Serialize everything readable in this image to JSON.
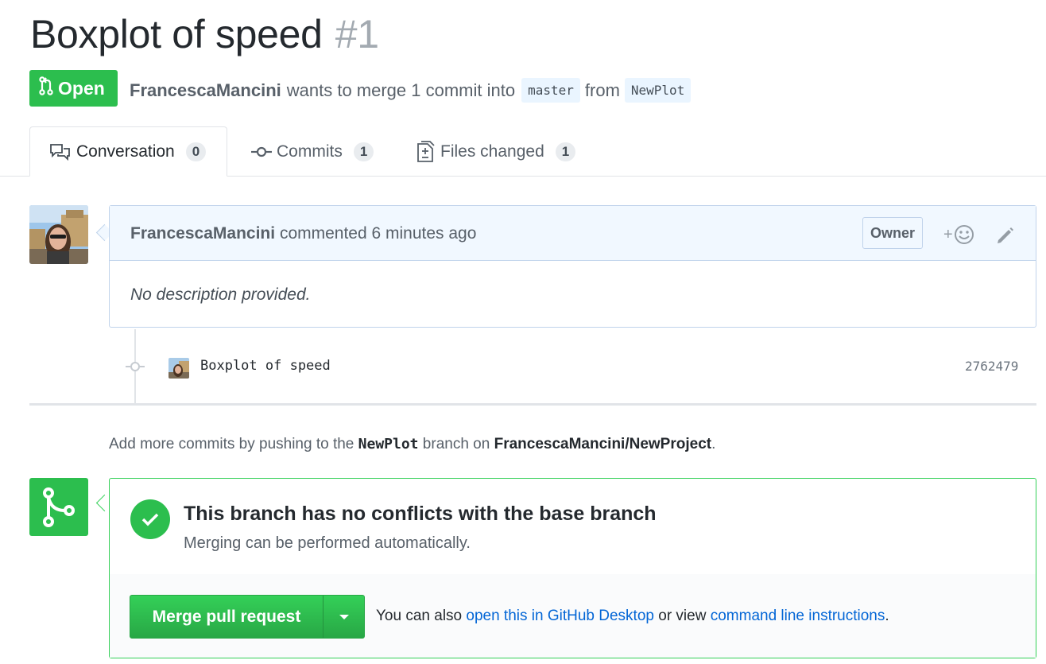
{
  "pr": {
    "title": "Boxplot of speed",
    "number": "#1",
    "state": "Open",
    "author": "FrancescaMancini",
    "summary": "wants to merge 1 commit into",
    "base_branch": "master",
    "from_word": "from",
    "head_branch": "NewPlot"
  },
  "tabs": [
    {
      "label": "Conversation",
      "count": "0",
      "icon": "comment-discussion-icon",
      "selected": true
    },
    {
      "label": "Commits",
      "count": "1",
      "icon": "git-commit-icon",
      "selected": false
    },
    {
      "label": "Files changed",
      "count": "1",
      "icon": "diff-icon",
      "selected": false
    }
  ],
  "comment": {
    "author": "FrancescaMancini",
    "action": "commented 6 minutes ago",
    "badge": "Owner",
    "body": "No description provided.",
    "reaction_plus": "+"
  },
  "commit": {
    "message": "Boxplot of speed",
    "sha": "2762479"
  },
  "help": {
    "prefix": "Add more commits by pushing to the",
    "branch": "NewPlot",
    "middle": "branch on",
    "repo": "FrancescaMancini/NewProject",
    "suffix": "."
  },
  "merge": {
    "title": "This branch has no conflicts with the base branch",
    "subtitle": "Merging can be performed automatically.",
    "button_label": "Merge pull request",
    "alt_prefix": "You can also",
    "desktop_link": "open this in GitHub Desktop",
    "alt_middle": "or view",
    "cli_link": "command line instructions",
    "alt_suffix": "."
  },
  "colors": {
    "green": "#2cbe4e",
    "link": "#0366d6",
    "header_bg": "#f1f8ff"
  }
}
